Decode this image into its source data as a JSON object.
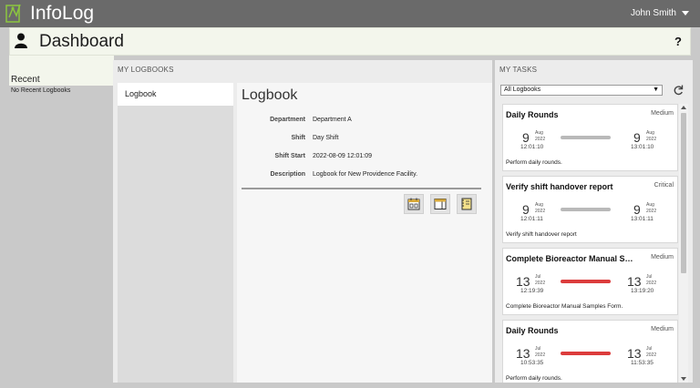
{
  "app": {
    "title": "InfoLog",
    "user": "John Smith"
  },
  "dashboard": {
    "title": "Dashboard",
    "help": "?"
  },
  "recent": {
    "title": "Recent",
    "empty": "No Recent Logbooks"
  },
  "my_logbooks": {
    "label": "MY LOGBOOKS",
    "items": [
      {
        "label": "Logbook"
      }
    ],
    "detail": {
      "title": "Logbook",
      "fields": [
        {
          "key": "Department",
          "value": "Department A"
        },
        {
          "key": "Shift",
          "value": "Day Shift"
        },
        {
          "key": "Shift Start",
          "value": "2022-08-09 12:01:09"
        },
        {
          "key": "Description",
          "value": "Logbook for New Providence Facility."
        }
      ],
      "actions": [
        "calendar-icon",
        "layout-icon",
        "notebook-icon"
      ]
    }
  },
  "my_tasks": {
    "label": "MY TASKS",
    "filter": "All Logbooks",
    "tasks": [
      {
        "name": "Daily Rounds",
        "priority": "Medium",
        "start": {
          "day": "9",
          "month": "Aug",
          "year": "2022",
          "time": "12:01:10"
        },
        "end": {
          "day": "9",
          "month": "Aug",
          "year": "2022",
          "time": "13:01:10"
        },
        "status_color": "#b9b9b9",
        "description": "Perform daily rounds."
      },
      {
        "name": "Verify shift handover report",
        "priority": "Critical",
        "start": {
          "day": "9",
          "month": "Aug",
          "year": "2022",
          "time": "12:01:11"
        },
        "end": {
          "day": "9",
          "month": "Aug",
          "year": "2022",
          "time": "13:01:11"
        },
        "status_color": "#b9b9b9",
        "description": "Verify shift handover report"
      },
      {
        "name": "Complete Bioreactor Manual Sa...",
        "priority": "Medium",
        "start": {
          "day": "13",
          "month": "Jul",
          "year": "2022",
          "time": "12:19:39"
        },
        "end": {
          "day": "13",
          "month": "Jul",
          "year": "2022",
          "time": "13:19:20"
        },
        "status_color": "#dc3c3c",
        "description": "Complete Bioreactor Manual Samples Form."
      },
      {
        "name": "Daily Rounds",
        "priority": "Medium",
        "start": {
          "day": "13",
          "month": "Jul",
          "year": "2022",
          "time": "10:53:35"
        },
        "end": {
          "day": "13",
          "month": "Jul",
          "year": "2022",
          "time": "11:53:35"
        },
        "status_color": "#dc3c3c",
        "description": "Perform daily rounds."
      }
    ]
  }
}
